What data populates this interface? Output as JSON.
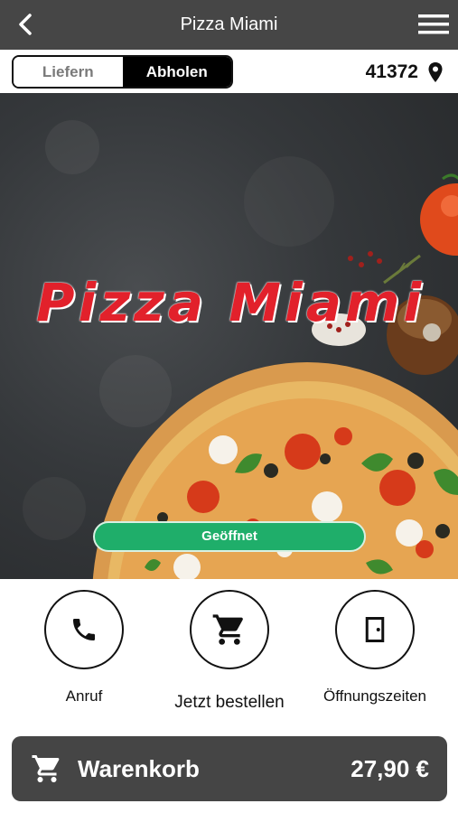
{
  "header": {
    "title": "Pizza Miami",
    "back_icon": "chevron-left-icon",
    "menu_icon": "hamburger-menu-icon"
  },
  "order_mode": {
    "options": [
      "Liefern",
      "Abholen"
    ],
    "selected": "Abholen"
  },
  "location": {
    "zip": "41372",
    "icon": "location-pin-icon"
  },
  "hero": {
    "brand": "Pizza Miami",
    "status": "Geöffnet",
    "status_color": "#1fae6a"
  },
  "actions": [
    {
      "label": "Anruf",
      "icon": "phone-icon"
    },
    {
      "label": "Jetzt bestellen",
      "icon": "shopping-cart-icon"
    },
    {
      "label": "Öffnungszeiten",
      "icon": "door-icon"
    }
  ],
  "cart": {
    "label": "Warenkorb",
    "total": "27,90 €",
    "icon": "shopping-cart-icon"
  },
  "colors": {
    "header_bg": "#464646",
    "brand_red": "#e2212b",
    "cart_bg": "#454545"
  }
}
